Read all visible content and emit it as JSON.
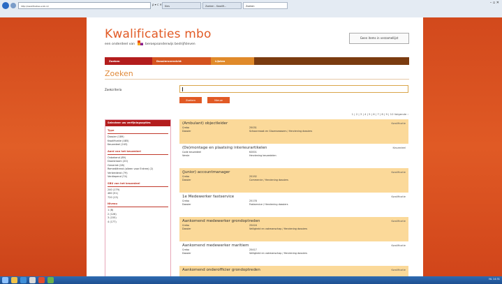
{
  "browser": {
    "address": "http://kwalificaties.s-bb.nl/",
    "addr_controls": "ρ ▾ c ✕",
    "tabs": [
      {
        "label": "Kies"
      },
      {
        "label": "Zoeken - Kwalifi..."
      },
      {
        "label": "Zoeken"
      }
    ],
    "window_controls": "– ▫ ✕"
  },
  "site": {
    "brand": "Kwalificaties mbo",
    "subtitle_prefix": "een onderdeel van",
    "subtitle_suffix": "beroepsonderwijs bedrijfsleven",
    "collection_button": "Geen items in verzamellijst"
  },
  "nav": [
    "Zoeken",
    "Dossieroverzicht",
    "Lijsten"
  ],
  "search": {
    "title": "Zoeken",
    "criteria_label": "Zoekcriteria",
    "input_value": "",
    "search_button": "Zoeken",
    "reset_button": "Nieuw"
  },
  "pager": {
    "text": "1 | 2 | 3 | 4 | 5 | 6 | 7 | 8 | 9 | 10   Volgende ›"
  },
  "filters": {
    "heading": "Selecteer uw verfijningsopties",
    "sections": [
      {
        "title": "Type",
        "items": [
          "Dossier (189)",
          "Kwalificatie (485)",
          "Keuzedeel (243)"
        ]
      },
      {
        "title": "Aard van het keuzedeel",
        "items": [
          "Onbekend (89)",
          "Doorstroom (20)",
          "Generiek (28)",
          "Remediërend (alleen voor Entree) (2)",
          "Verbredend (79)",
          "Verdiepend (74)"
        ]
      },
      {
        "title": "SBU van het keuzedeel",
        "items": [
          "240 (179)",
          "480 (51)",
          "720 (13)"
        ]
      },
      {
        "title": "Niveau",
        "items": [
          "1 (8)",
          "2 (126)",
          "3 (155)",
          "4 (177)"
        ]
      }
    ]
  },
  "results": [
    {
      "title": "(Ambulant) objectleider",
      "type": "Kwalificatie",
      "highlight": true,
      "rows": [
        {
          "k": "Crebo",
          "v": "25031"
        },
        {
          "k": "Dossier",
          "v": "Schoonmaak en Glazenwassers / Herziening dossiers"
        }
      ]
    },
    {
      "title": "(De)montage en plaatsing interieurartikelen",
      "type": "Keuzedeel",
      "highlight": false,
      "rows": [
        {
          "k": "Code keuzedeel",
          "v": "K0001"
        },
        {
          "k": "Versie",
          "v": "Herziening keuzedelen"
        }
      ]
    },
    {
      "title": "(Junior) accountmanager",
      "type": "Kwalificatie",
      "highlight": true,
      "rows": [
        {
          "k": "Crebo",
          "v": "25192"
        },
        {
          "k": "Dossier",
          "v": "Commercie / Herziening dossiers"
        }
      ]
    },
    {
      "title": "1e Medewerker fastservice",
      "type": "Kwalificatie",
      "highlight": false,
      "rows": [
        {
          "k": "Crebo",
          "v": "25178"
        },
        {
          "k": "Dossier",
          "v": "Fastservice / Herziening dossiers"
        }
      ]
    },
    {
      "title": "Aankomend medewerker grondoptreden",
      "type": "Kwalificatie",
      "highlight": true,
      "rows": [
        {
          "k": "Crebo",
          "v": "25416"
        },
        {
          "k": "Dossier",
          "v": "Veiligheid en vakmanschap / Herziening dossiers"
        }
      ]
    },
    {
      "title": "Aankomend medewerker maritiem",
      "type": "Kwalificatie",
      "highlight": false,
      "rows": [
        {
          "k": "Crebo",
          "v": "25417"
        },
        {
          "k": "Dossier",
          "v": "Veiligheid en vakmanschap / Herziening dossiers"
        }
      ]
    },
    {
      "title": "Aankomend onderofficier grondoptreden",
      "type": "Kwalificatie",
      "highlight": true,
      "rows": [
        {
          "k": "",
          "v": ""
        },
        {
          "k": "",
          "v": ""
        }
      ]
    }
  ],
  "taskbar": {
    "clock": "NL  14:31"
  },
  "colors": {
    "brand": "#e15a25",
    "nav": "#7a3b10",
    "highlight": "#fbd999",
    "filter_head": "#b31d1d"
  }
}
